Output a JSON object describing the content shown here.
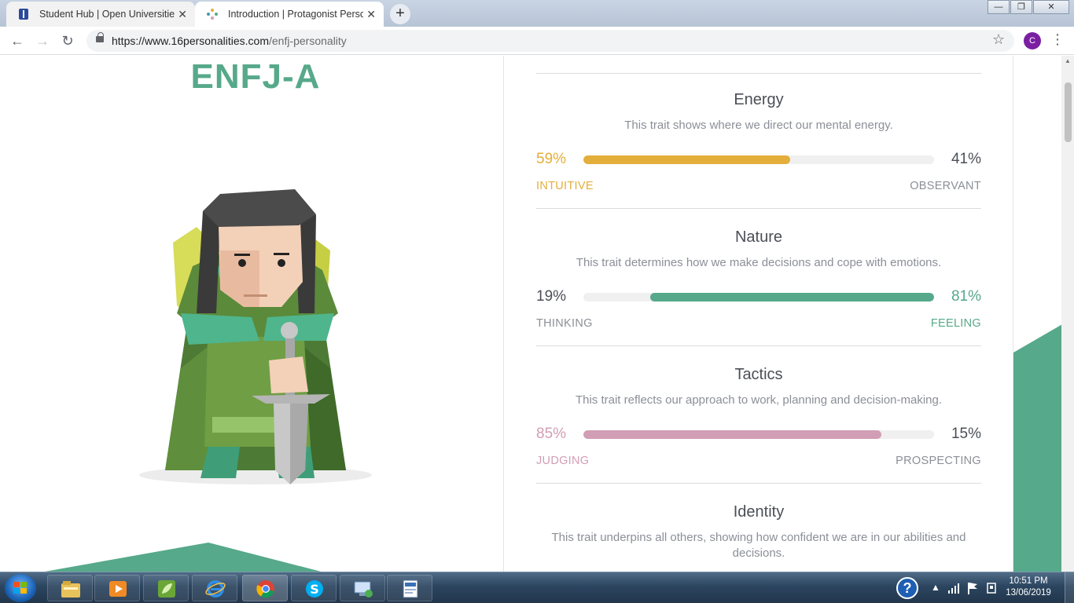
{
  "browser": {
    "tabs": [
      {
        "title": "Student Hub | Open Universities",
        "active": false
      },
      {
        "title": "Introduction | Protagonist Person",
        "active": true
      }
    ],
    "new_tab": "+",
    "close_glyph": "✕",
    "url_host": "https://www.16personalities.com",
    "url_path": "/enfj-personality",
    "profile_initial": "C",
    "window_buttons": {
      "minimize": "—",
      "restore": "❐",
      "close": "✕"
    }
  },
  "page": {
    "personality_type": "ENFJ-A",
    "traits": [
      {
        "name": "Energy",
        "description": "This trait shows where we direct our mental energy.",
        "left_percent": "59%",
        "right_percent": "41%",
        "left_label": "INTUITIVE",
        "right_label": "OBSERVANT",
        "dominant": "left",
        "fill_fraction": 0.59,
        "color": "#e4ae3a"
      },
      {
        "name": "Nature",
        "description": "This trait determines how we make decisions and cope with emotions.",
        "left_percent": "19%",
        "right_percent": "81%",
        "left_label": "THINKING",
        "right_label": "FEELING",
        "dominant": "right",
        "fill_fraction": 0.81,
        "color": "#56a98a"
      },
      {
        "name": "Tactics",
        "description": "This trait reflects our approach to work, planning and decision-making.",
        "left_percent": "85%",
        "right_percent": "15%",
        "left_label": "JUDGING",
        "right_label": "PROSPECTING",
        "dominant": "left",
        "fill_fraction": 0.85,
        "color": "#d29eb5"
      },
      {
        "name": "Identity",
        "description": "This trait underpins all others, showing how confident we are in our abilities and decisions."
      }
    ]
  },
  "taskbar": {
    "time": "10:51 PM",
    "date": "13/06/2019",
    "icons": [
      "file-explorer-icon",
      "media-player-icon",
      "notepad-leaf-icon",
      "internet-explorer-icon",
      "chrome-icon",
      "skype-icon",
      "remote-desktop-icon",
      "document-icon"
    ]
  }
}
